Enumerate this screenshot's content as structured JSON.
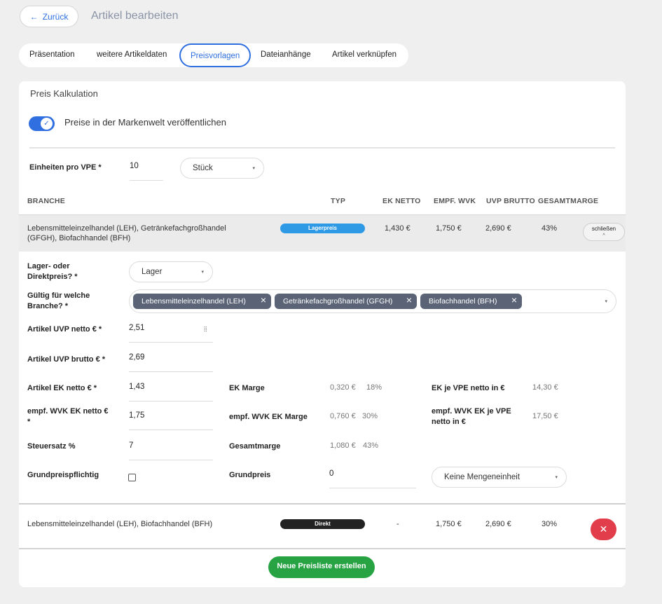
{
  "header": {
    "back_label": "Zurück",
    "title": "Artikel bearbeiten"
  },
  "tabs": [
    {
      "label": "Präsentation"
    },
    {
      "label": "weitere Artikeldaten"
    },
    {
      "label": "Preisvorlagen",
      "active": true
    },
    {
      "label": "Dateianhänge"
    },
    {
      "label": "Artikel verknüpfen"
    }
  ],
  "card": {
    "title": "Preis Kalkulation",
    "publish_toggle": {
      "label": "Preise in der Markenwelt veröffentlichen",
      "on": true
    },
    "units": {
      "label": "Einheiten pro VPE *",
      "value": "10",
      "unit_select": "Stück"
    }
  },
  "table": {
    "headers": [
      "BRANCHE",
      "TYP",
      "EK NETTO",
      "EMPF. WVK",
      "UVP BRUTTO",
      "GESAMTMARGE"
    ],
    "rows": [
      {
        "branche_line1": "Lebensmitteleinzelhandel (LEH), Getränkefachgroßhandel",
        "branche_line2": "(GFGH), Biofachhandel (BFH)",
        "typ": "Lagerpreis",
        "ek_netto": "1,430 €",
        "empf_wvk": "1,750 €",
        "uvp_brutto": "2,690 €",
        "gesamtmarge": "43%",
        "action": "schließen"
      },
      {
        "branche_line1": "Lebensmitteleinzelhandel (LEH), Biofachhandel (BFH)",
        "typ": "Direkt",
        "ek_netto": "-",
        "empf_wvk": "1,750 €",
        "uvp_brutto": "2,690 €",
        "gesamtmarge": "30%"
      }
    ]
  },
  "detail": {
    "price_type": {
      "label_l1": "Lager- oder",
      "label_l2": "Direktpreis? *",
      "value": "Lager"
    },
    "branches": {
      "label_l1": "Gültig für welche",
      "label_l2": "Branche? *",
      "tags": [
        "Lebensmitteleinzelhandel (LEH)",
        "Getränkefachgroßhandel (GFGH)",
        "Biofachhandel (BFH)"
      ]
    },
    "uvp_netto": {
      "label": "Artikel UVP netto € *",
      "value": "2,51"
    },
    "uvp_brutto": {
      "label": "Artikel UVP brutto € *",
      "value": "2,69"
    },
    "ek_netto": {
      "label": "Artikel EK netto € *",
      "value": "1,43"
    },
    "wvk_ek_netto": {
      "label_l1": "empf. WVK EK netto €",
      "label_l2": "*",
      "value": "1,75"
    },
    "steuersatz": {
      "label": "Steuersatz %",
      "value": "7"
    },
    "grundpreispflichtig": {
      "label": "Grundpreispflichtig",
      "checked": false
    },
    "ek_marge": {
      "label": "EK Marge",
      "value": "0,320 €",
      "percent": "18%"
    },
    "wvk_ek_marge": {
      "label": "empf. WVK EK Marge",
      "value": "0,760 €",
      "percent": "30%"
    },
    "gesamtmarge": {
      "label": "Gesamtmarge",
      "value": "1,080 €",
      "percent": "43%"
    },
    "grundpreis": {
      "label": "Grundpreis",
      "value": "0"
    },
    "ek_je_vpe": {
      "label": "EK je VPE netto in €",
      "value": "14,30 €"
    },
    "wvk_ek_je_vpe": {
      "label_l1": "empf. WVK EK je VPE",
      "label_l2": "netto in €",
      "value": "17,50 €"
    },
    "mengeneinheit": {
      "value": "Keine Mengeneinheit"
    }
  },
  "footer": {
    "create_label": "Neue Preisliste erstellen"
  },
  "colors": {
    "accent": "#2f6fe0",
    "success": "#27a343",
    "danger": "#e23d4b",
    "badge_blue": "#2e9ae6"
  }
}
